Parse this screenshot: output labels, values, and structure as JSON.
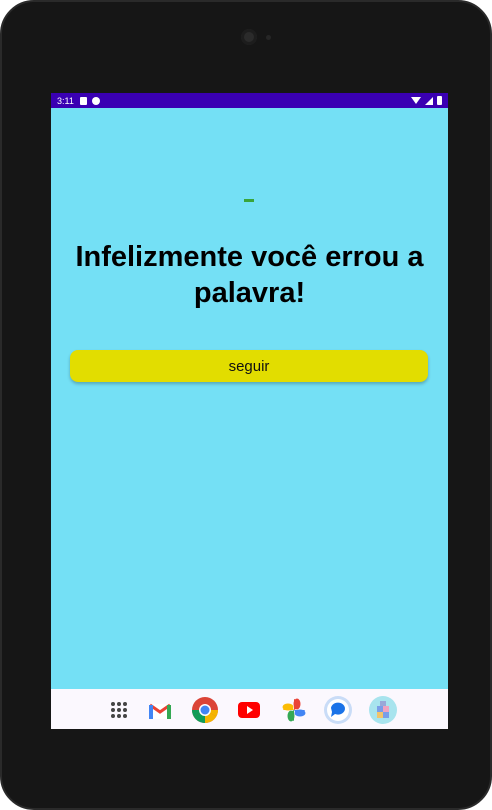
{
  "status_bar": {
    "time": "3:11"
  },
  "main": {
    "dash": "-",
    "headline": "Infelizmente você errou a palavra!",
    "button_label": "seguir"
  },
  "dock": {
    "apps": [
      "app-drawer-icon",
      "gmail-icon",
      "chrome-icon",
      "youtube-icon",
      "photos-icon",
      "messages-icon",
      "store-icon"
    ]
  },
  "colors": {
    "background": "#74e0f5",
    "status_bar": "#3a00b3",
    "button": "#e2dd00",
    "dash": "#3aa53a"
  }
}
